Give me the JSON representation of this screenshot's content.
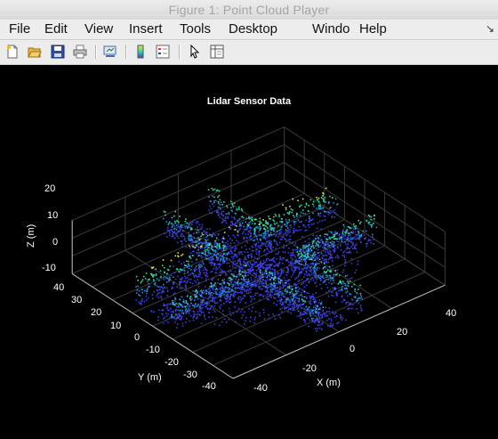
{
  "window": {
    "title": "Figure 1: Point Cloud Player"
  },
  "menu": {
    "items": [
      "File",
      "Edit",
      "View",
      "Insert",
      "Tools",
      "Desktop",
      "Windo",
      "Help"
    ],
    "dock_icon": "dock-arrow-icon"
  },
  "toolbar": {
    "tools": [
      "new-figure-icon",
      "open-file-icon",
      "save-icon",
      "print-icon",
      "link-plot-icon",
      "colorbar-icon",
      "legend-icon",
      "pointer-icon",
      "property-inspector-icon"
    ]
  },
  "colors": {
    "background": "#000000",
    "grid": "#3a3a3a",
    "points_low": "#3a3fe0",
    "points_mid": "#1f8fd6",
    "points_high": "#2fd8a8",
    "points_top": "#e6e633"
  },
  "chart_data": {
    "type": "scatter",
    "title": "Lidar Sensor Data",
    "xlabel": "X (m)",
    "ylabel": "Y (m)",
    "zlabel": "Z (m)",
    "x_ticks": [
      "-40",
      "-20",
      "0",
      "20",
      "40"
    ],
    "y_ticks": [
      "40",
      "30",
      "20",
      "10",
      "0",
      "-10",
      "-20",
      "-30",
      "-40"
    ],
    "z_ticks": [
      "20",
      "10",
      "0",
      "-10"
    ],
    "xlim": [
      -40,
      40
    ],
    "ylim": [
      -40,
      40
    ],
    "zlim": [
      -10,
      20
    ],
    "grid": true,
    "colormap": "parula (by height)"
  }
}
